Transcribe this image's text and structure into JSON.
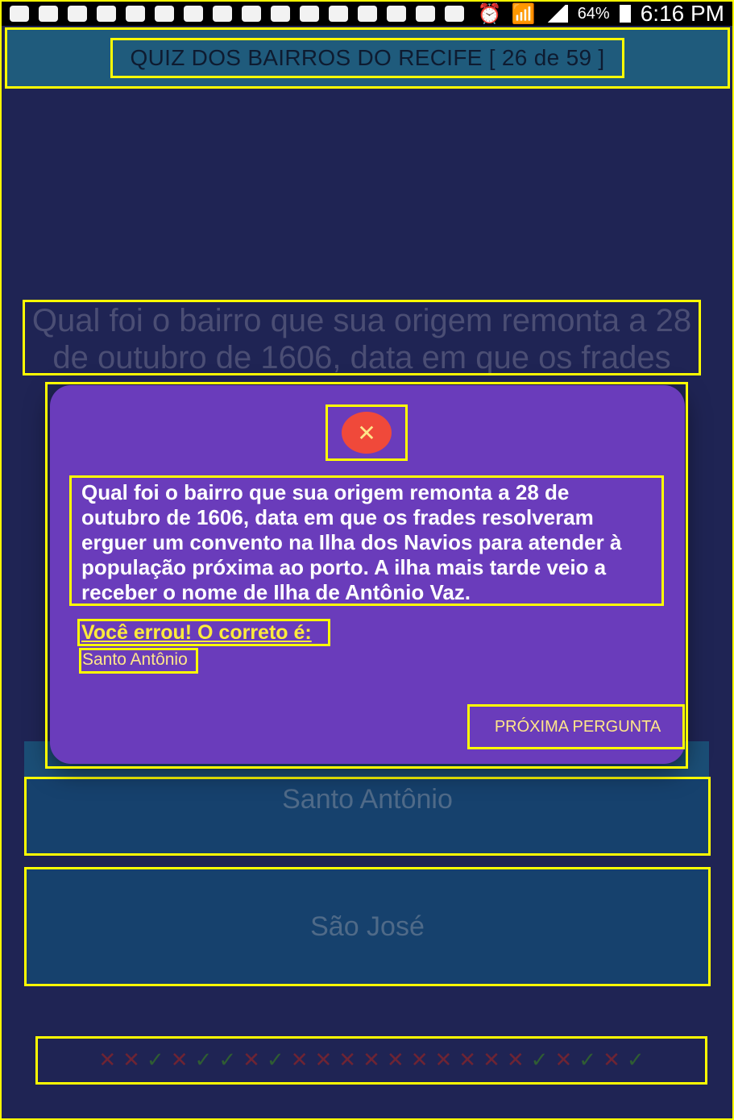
{
  "status_bar": {
    "battery": "64%",
    "time": "6:16 PM"
  },
  "header": {
    "title": "QUIZ DOS BAIRROS DO RECIFE [ 26 de 59 ]"
  },
  "background_question": {
    "text": "Qual foi o bairro que sua origem remonta a 28 de outubro de 1606, data em que os frades resolveram erguer um convento na Ilha dos Navios para atender à população próxima ao porto. A ilha mais tarde veio a receber o nome de Ilha de Antônio Vaz."
  },
  "answers": [
    {
      "label": "Santo Antônio"
    },
    {
      "label": "São José"
    }
  ],
  "history": [
    "x",
    "x",
    "ok",
    "x",
    "ok",
    "ok",
    "x",
    "ok",
    "x",
    "x",
    "x",
    "x",
    "x",
    "x",
    "x",
    "x",
    "x",
    "x",
    "ok",
    "x",
    "ok",
    "x",
    "ok"
  ],
  "colors": {
    "background": "#1f2454",
    "dialog": "#6a3cbb",
    "wrong": "#ffeb3b",
    "error_icon": "#f0493a",
    "correct_mark": "#2f5d33",
    "wrong_mark": "#6e2434"
  },
  "dialog": {
    "icon": "close-icon",
    "icon_glyph": "✕",
    "question": "Qual foi o bairro que sua origem remonta a 28 de outubro de 1606, data em que os frades resolveram erguer um convento na Ilha dos Navios para atender à população próxima ao porto. A ilha mais tarde veio a receber o nome de Ilha de Antônio Vaz.",
    "wrong_label": "Você errou! O correto é:",
    "correct_answer": "Santo Antônio",
    "next_button": "PRÓXIMA PERGUNTA"
  }
}
